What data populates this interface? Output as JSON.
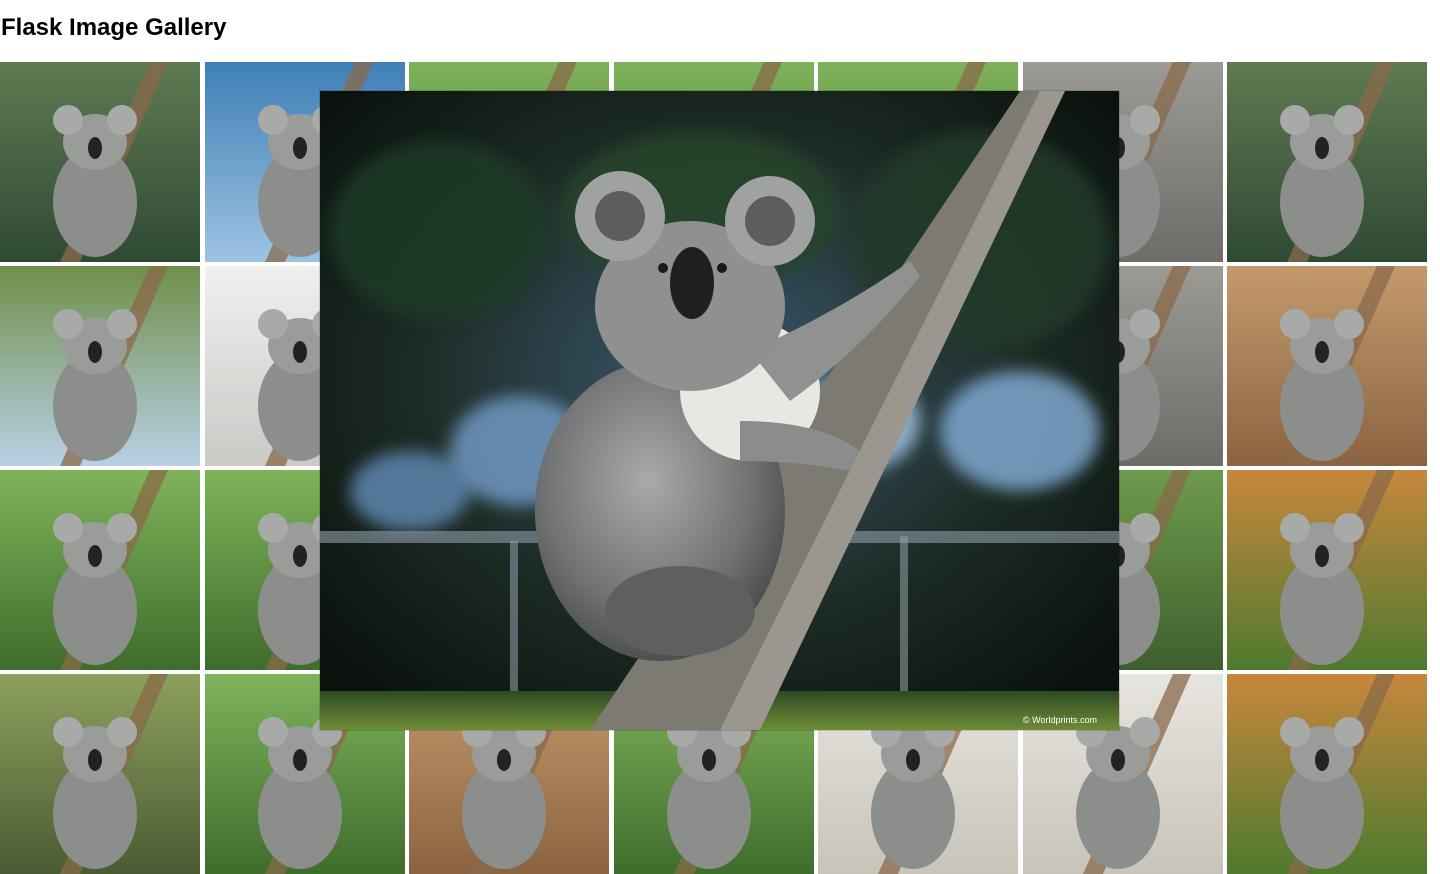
{
  "page": {
    "title": "Flask Image Gallery"
  },
  "colors": {
    "background": "#ffffff",
    "title": "#000000"
  },
  "gallery": {
    "rows": 4,
    "columns": 7,
    "thumbnails": [
      {
        "subject": "koala-climbing-branch",
        "scene": "forest"
      },
      {
        "subject": "koala-between-trunks",
        "scene": "blue-sky"
      },
      {
        "subject": "koala-pair-on-branch",
        "scene": "green-leaves"
      },
      {
        "subject": "koala-pair-on-branch",
        "scene": "green-leaves"
      },
      {
        "subject": "koala-in-leaves",
        "scene": "green-leaves"
      },
      {
        "subject": "koala-closeup-fur",
        "scene": "grey"
      },
      {
        "subject": "koala-climbing-branch",
        "scene": "forest"
      },
      {
        "subject": "koala-in-fork",
        "scene": "eucalyptus"
      },
      {
        "subject": "koala-dark-sitting",
        "scene": "white"
      },
      {
        "subject": "koala",
        "scene": "covered"
      },
      {
        "subject": "koala",
        "scene": "covered"
      },
      {
        "subject": "koala",
        "scene": "covered"
      },
      {
        "subject": "koala-leaning",
        "scene": "grey"
      },
      {
        "subject": "koala-standing-on-log",
        "scene": "tan"
      },
      {
        "subject": "koala-on-branch",
        "scene": "green-leaves"
      },
      {
        "subject": "koala-on-branch",
        "scene": "green-leaves"
      },
      {
        "subject": "koala",
        "scene": "covered"
      },
      {
        "subject": "koala",
        "scene": "covered"
      },
      {
        "subject": "koala",
        "scene": "covered"
      },
      {
        "subject": "koala-climbing-trunk",
        "scene": "green"
      },
      {
        "subject": "koala-in-eucalyptus",
        "scene": "orange-leaves"
      },
      {
        "subject": "koala-brown-closeup",
        "scene": "leaves"
      },
      {
        "subject": "koala-on-branch",
        "scene": "green-leaves"
      },
      {
        "subject": "koala-standing",
        "scene": "tan"
      },
      {
        "subject": "koala-on-branch",
        "scene": "green-leaves"
      },
      {
        "subject": "koala-mother-joey",
        "scene": "light"
      },
      {
        "subject": "koala-mother-joey",
        "scene": "light"
      },
      {
        "subject": "koala-in-eucalyptus",
        "scene": "orange-leaves"
      }
    ]
  },
  "lightbox": {
    "subject": "koala-climbing-tree",
    "credit": "© Worldprints.com"
  }
}
